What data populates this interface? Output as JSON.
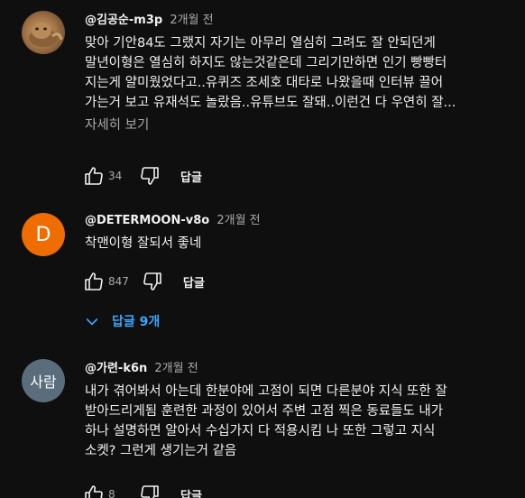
{
  "comments": [
    {
      "author": "@김공순-m3p",
      "time": "2개월 전",
      "lines": [
        "맞아 기안84도 그랬지 자기는 아무리 열심히 그려도 잘 안되던게",
        "말년이형은 열심히 하지도 않는것같은데 그리기만하면 인기 빵빵터",
        "지는게 얄미웠었다고..유퀴즈 조세호 대타로 나왔을때 인터뷰 끌어",
        "가는거 보고 유재석도 놀랐음..유튜브도 잘돼..이런건 다 우연히 잘..."
      ],
      "more": "자세히 보기",
      "likes": "34",
      "reply": "답글"
    },
    {
      "author": "@DETERMOON-v8o",
      "time": "2개월 전",
      "avatar_letter": "D",
      "lines": [
        "착맨이형 잘되서 좋네"
      ],
      "likes": "847",
      "reply": "답글",
      "replies_label": "답글 9개"
    },
    {
      "author": "@가련-k6n",
      "time": "2개월 전",
      "avatar_text": "사람",
      "lines": [
        "내가 겪어봐서 아는데 한분야에 고점이 되면 다른분야 지식 또한 잘",
        "받아드리게됨 훈련한 과정이 있어서 주변 고점 찍은 동료들도 내가",
        "하나 설명하면 알아서 수십가지 다 적용시킴 나 또한 그렇고 지식",
        "소켓? 그런게 생기는거 같음"
      ],
      "likes": "8",
      "reply": "답글"
    }
  ],
  "colors": {
    "background": "#0f0f0f",
    "link": "#3ea6ff",
    "secondary": "#aaaaaa",
    "avatar_d": "#ef6c00",
    "avatar_text": "#596d7c"
  }
}
